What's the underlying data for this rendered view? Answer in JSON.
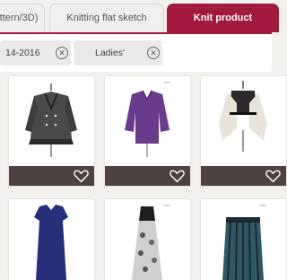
{
  "tabs": [
    {
      "label": "ttern/3D)",
      "active": false
    },
    {
      "label": "Knitting flat sketch",
      "active": false
    },
    {
      "label": "Knit product",
      "active": true
    }
  ],
  "filters": [
    {
      "label": "14-2016"
    },
    {
      "label": "Ladies'"
    }
  ],
  "products": [
    {
      "id": "coat-tweed",
      "icon": "heart-icon"
    },
    {
      "id": "sweater-purple",
      "icon": "heart-icon"
    },
    {
      "id": "cardigan-cream",
      "icon": "heart-icon"
    },
    {
      "id": "dress-navy"
    },
    {
      "id": "dress-floral"
    },
    {
      "id": "skirt-teal"
    }
  ],
  "colors": {
    "accent": "#a11a3d",
    "card_bar": "#4e4142",
    "background": "#f3f1ee"
  }
}
